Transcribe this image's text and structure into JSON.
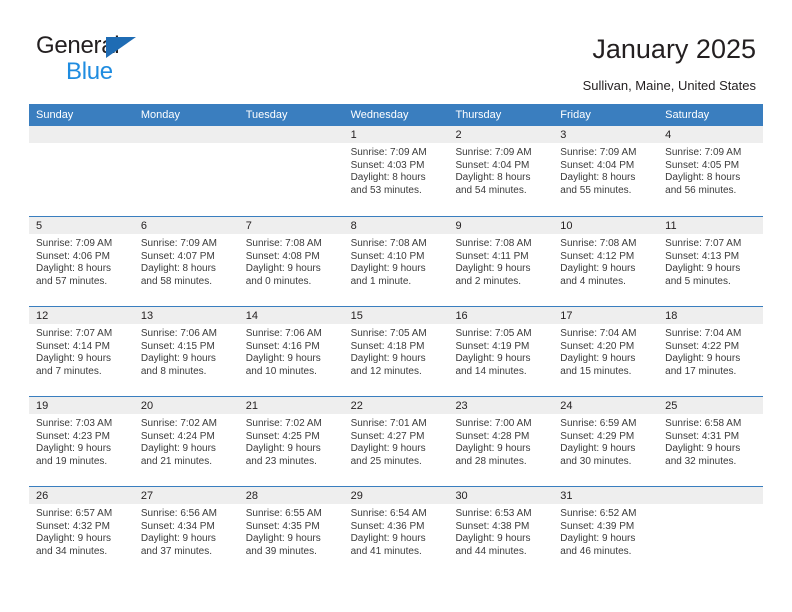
{
  "brand": {
    "name_part1": "General",
    "name_part2": "Blue",
    "accent_dark": "#1f6cb4",
    "accent_light": "#1f8ce0"
  },
  "header": {
    "title": "January 2025",
    "subtitle": "Sullivan, Maine, United States"
  },
  "calendar": {
    "header_bg": "#3a7ebf",
    "daynum_bg": "#eeeeee",
    "weekdays": [
      "Sunday",
      "Monday",
      "Tuesday",
      "Wednesday",
      "Thursday",
      "Friday",
      "Saturday"
    ],
    "weeks": [
      [
        {
          "day": "",
          "sunrise": "",
          "sunset": "",
          "daylight_line1": "",
          "daylight_line2": ""
        },
        {
          "day": "",
          "sunrise": "",
          "sunset": "",
          "daylight_line1": "",
          "daylight_line2": ""
        },
        {
          "day": "",
          "sunrise": "",
          "sunset": "",
          "daylight_line1": "",
          "daylight_line2": ""
        },
        {
          "day": "1",
          "sunrise": "Sunrise: 7:09 AM",
          "sunset": "Sunset: 4:03 PM",
          "daylight_line1": "Daylight: 8 hours",
          "daylight_line2": "and 53 minutes."
        },
        {
          "day": "2",
          "sunrise": "Sunrise: 7:09 AM",
          "sunset": "Sunset: 4:04 PM",
          "daylight_line1": "Daylight: 8 hours",
          "daylight_line2": "and 54 minutes."
        },
        {
          "day": "3",
          "sunrise": "Sunrise: 7:09 AM",
          "sunset": "Sunset: 4:04 PM",
          "daylight_line1": "Daylight: 8 hours",
          "daylight_line2": "and 55 minutes."
        },
        {
          "day": "4",
          "sunrise": "Sunrise: 7:09 AM",
          "sunset": "Sunset: 4:05 PM",
          "daylight_line1": "Daylight: 8 hours",
          "daylight_line2": "and 56 minutes."
        }
      ],
      [
        {
          "day": "5",
          "sunrise": "Sunrise: 7:09 AM",
          "sunset": "Sunset: 4:06 PM",
          "daylight_line1": "Daylight: 8 hours",
          "daylight_line2": "and 57 minutes."
        },
        {
          "day": "6",
          "sunrise": "Sunrise: 7:09 AM",
          "sunset": "Sunset: 4:07 PM",
          "daylight_line1": "Daylight: 8 hours",
          "daylight_line2": "and 58 minutes."
        },
        {
          "day": "7",
          "sunrise": "Sunrise: 7:08 AM",
          "sunset": "Sunset: 4:08 PM",
          "daylight_line1": "Daylight: 9 hours",
          "daylight_line2": "and 0 minutes."
        },
        {
          "day": "8",
          "sunrise": "Sunrise: 7:08 AM",
          "sunset": "Sunset: 4:10 PM",
          "daylight_line1": "Daylight: 9 hours",
          "daylight_line2": "and 1 minute."
        },
        {
          "day": "9",
          "sunrise": "Sunrise: 7:08 AM",
          "sunset": "Sunset: 4:11 PM",
          "daylight_line1": "Daylight: 9 hours",
          "daylight_line2": "and 2 minutes."
        },
        {
          "day": "10",
          "sunrise": "Sunrise: 7:08 AM",
          "sunset": "Sunset: 4:12 PM",
          "daylight_line1": "Daylight: 9 hours",
          "daylight_line2": "and 4 minutes."
        },
        {
          "day": "11",
          "sunrise": "Sunrise: 7:07 AM",
          "sunset": "Sunset: 4:13 PM",
          "daylight_line1": "Daylight: 9 hours",
          "daylight_line2": "and 5 minutes."
        }
      ],
      [
        {
          "day": "12",
          "sunrise": "Sunrise: 7:07 AM",
          "sunset": "Sunset: 4:14 PM",
          "daylight_line1": "Daylight: 9 hours",
          "daylight_line2": "and 7 minutes."
        },
        {
          "day": "13",
          "sunrise": "Sunrise: 7:06 AM",
          "sunset": "Sunset: 4:15 PM",
          "daylight_line1": "Daylight: 9 hours",
          "daylight_line2": "and 8 minutes."
        },
        {
          "day": "14",
          "sunrise": "Sunrise: 7:06 AM",
          "sunset": "Sunset: 4:16 PM",
          "daylight_line1": "Daylight: 9 hours",
          "daylight_line2": "and 10 minutes."
        },
        {
          "day": "15",
          "sunrise": "Sunrise: 7:05 AM",
          "sunset": "Sunset: 4:18 PM",
          "daylight_line1": "Daylight: 9 hours",
          "daylight_line2": "and 12 minutes."
        },
        {
          "day": "16",
          "sunrise": "Sunrise: 7:05 AM",
          "sunset": "Sunset: 4:19 PM",
          "daylight_line1": "Daylight: 9 hours",
          "daylight_line2": "and 14 minutes."
        },
        {
          "day": "17",
          "sunrise": "Sunrise: 7:04 AM",
          "sunset": "Sunset: 4:20 PM",
          "daylight_line1": "Daylight: 9 hours",
          "daylight_line2": "and 15 minutes."
        },
        {
          "day": "18",
          "sunrise": "Sunrise: 7:04 AM",
          "sunset": "Sunset: 4:22 PM",
          "daylight_line1": "Daylight: 9 hours",
          "daylight_line2": "and 17 minutes."
        }
      ],
      [
        {
          "day": "19",
          "sunrise": "Sunrise: 7:03 AM",
          "sunset": "Sunset: 4:23 PM",
          "daylight_line1": "Daylight: 9 hours",
          "daylight_line2": "and 19 minutes."
        },
        {
          "day": "20",
          "sunrise": "Sunrise: 7:02 AM",
          "sunset": "Sunset: 4:24 PM",
          "daylight_line1": "Daylight: 9 hours",
          "daylight_line2": "and 21 minutes."
        },
        {
          "day": "21",
          "sunrise": "Sunrise: 7:02 AM",
          "sunset": "Sunset: 4:25 PM",
          "daylight_line1": "Daylight: 9 hours",
          "daylight_line2": "and 23 minutes."
        },
        {
          "day": "22",
          "sunrise": "Sunrise: 7:01 AM",
          "sunset": "Sunset: 4:27 PM",
          "daylight_line1": "Daylight: 9 hours",
          "daylight_line2": "and 25 minutes."
        },
        {
          "day": "23",
          "sunrise": "Sunrise: 7:00 AM",
          "sunset": "Sunset: 4:28 PM",
          "daylight_line1": "Daylight: 9 hours",
          "daylight_line2": "and 28 minutes."
        },
        {
          "day": "24",
          "sunrise": "Sunrise: 6:59 AM",
          "sunset": "Sunset: 4:29 PM",
          "daylight_line1": "Daylight: 9 hours",
          "daylight_line2": "and 30 minutes."
        },
        {
          "day": "25",
          "sunrise": "Sunrise: 6:58 AM",
          "sunset": "Sunset: 4:31 PM",
          "daylight_line1": "Daylight: 9 hours",
          "daylight_line2": "and 32 minutes."
        }
      ],
      [
        {
          "day": "26",
          "sunrise": "Sunrise: 6:57 AM",
          "sunset": "Sunset: 4:32 PM",
          "daylight_line1": "Daylight: 9 hours",
          "daylight_line2": "and 34 minutes."
        },
        {
          "day": "27",
          "sunrise": "Sunrise: 6:56 AM",
          "sunset": "Sunset: 4:34 PM",
          "daylight_line1": "Daylight: 9 hours",
          "daylight_line2": "and 37 minutes."
        },
        {
          "day": "28",
          "sunrise": "Sunrise: 6:55 AM",
          "sunset": "Sunset: 4:35 PM",
          "daylight_line1": "Daylight: 9 hours",
          "daylight_line2": "and 39 minutes."
        },
        {
          "day": "29",
          "sunrise": "Sunrise: 6:54 AM",
          "sunset": "Sunset: 4:36 PM",
          "daylight_line1": "Daylight: 9 hours",
          "daylight_line2": "and 41 minutes."
        },
        {
          "day": "30",
          "sunrise": "Sunrise: 6:53 AM",
          "sunset": "Sunset: 4:38 PM",
          "daylight_line1": "Daylight: 9 hours",
          "daylight_line2": "and 44 minutes."
        },
        {
          "day": "31",
          "sunrise": "Sunrise: 6:52 AM",
          "sunset": "Sunset: 4:39 PM",
          "daylight_line1": "Daylight: 9 hours",
          "daylight_line2": "and 46 minutes."
        },
        {
          "day": "",
          "sunrise": "",
          "sunset": "",
          "daylight_line1": "",
          "daylight_line2": ""
        }
      ]
    ]
  }
}
